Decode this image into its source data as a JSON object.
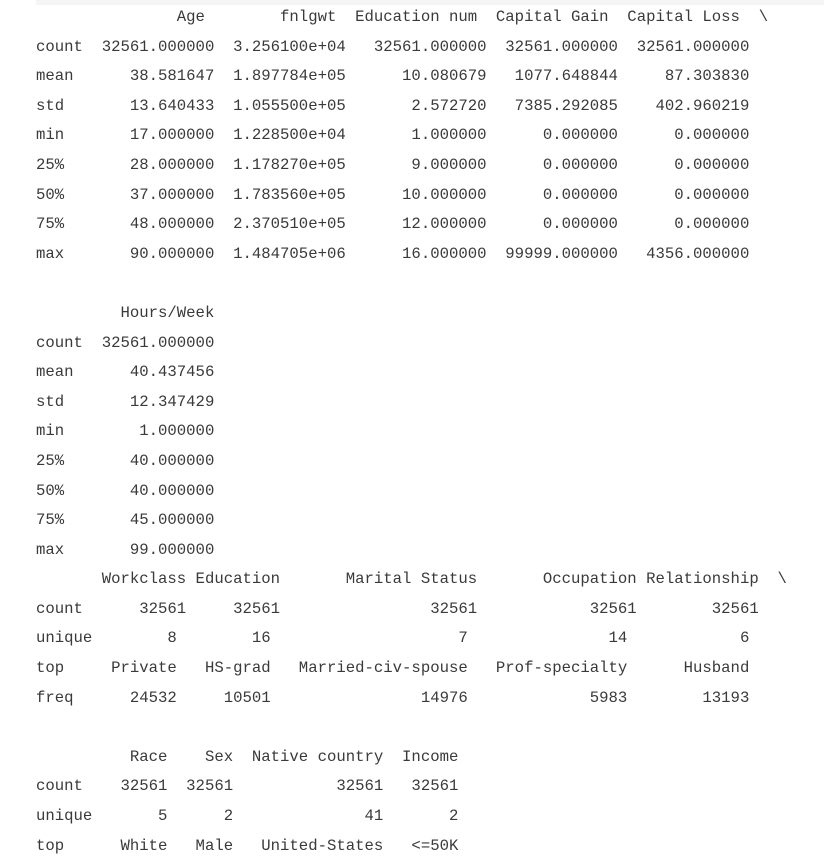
{
  "outputs": [
    {
      "lines": [
        "               Age        fnlgwt  Education num  Capital Gain  Capital Loss  \\",
        "count  32561.000000  3.256100e+04   32561.000000  32561.000000  32561.000000",
        "mean      38.581647  1.897784e+05      10.080679   1077.648844     87.303830",
        "std       13.640433  1.055500e+05       2.572720   7385.292085    402.960219",
        "min       17.000000  1.228500e+04       1.000000      0.000000      0.000000",
        "25%       28.000000  1.178270e+05       9.000000      0.000000      0.000000",
        "50%       37.000000  1.783560e+05      10.000000      0.000000      0.000000",
        "75%       48.000000  2.370510e+05      12.000000      0.000000      0.000000",
        "max       90.000000  1.484705e+06      16.000000  99999.000000   4356.000000",
        "",
        "         Hours/Week",
        "count  32561.000000",
        "mean      40.437456",
        "std       12.347429",
        "min        1.000000",
        "25%       40.000000",
        "50%       40.000000",
        "75%       45.000000",
        "max       99.000000"
      ]
    },
    {
      "lines": [
        "       Workclass Education       Marital Status       Occupation Relationship  \\",
        "count      32561     32561                32561            32561        32561",
        "unique        8        16                    7               14            6",
        "top     Private   HS-grad   Married-civ-spouse   Prof-specialty      Husband",
        "freq      24532     10501                14976             5983        13193",
        "",
        "          Race    Sex  Native country  Income",
        "count    32561  32561           32561   32561",
        "unique       5      2              41       2",
        "top      White   Male   United-States   <=50K"
      ]
    }
  ]
}
